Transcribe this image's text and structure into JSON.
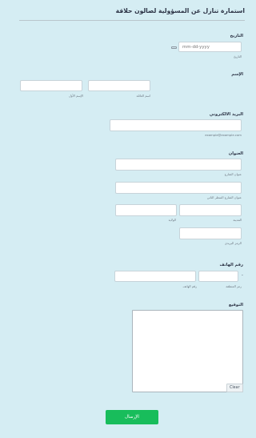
{
  "form": {
    "title": "استمارة تنازل عن المسؤولية لصالون حلاقة",
    "submit_label": "الإرسال"
  },
  "date": {
    "label": "التاريخ",
    "placeholder": "mm-dd-yyyy",
    "sublabel": "التاريخ"
  },
  "name": {
    "label": "الإسم",
    "first_sublabel": "الإسم الأول",
    "last_sublabel": "اسم العائلة"
  },
  "email": {
    "label": "البريد الالكتروني",
    "sublabel": "example@example.com"
  },
  "address": {
    "label": "العنوان",
    "street_sublabel": "عنوان الشارع",
    "street2_sublabel": "عنوان الشارع السطر الثاني",
    "city_sublabel": "المدينة",
    "state_sublabel": "الولاية",
    "zip_sublabel": "الرمز البريدي"
  },
  "phone": {
    "label": "رقم الهاتف",
    "area_sublabel": "رمز المنطقة",
    "number_sublabel": "رقم الهاتف",
    "separator": "-"
  },
  "signature": {
    "label": "التوقيع",
    "clear_label": "Clear"
  }
}
